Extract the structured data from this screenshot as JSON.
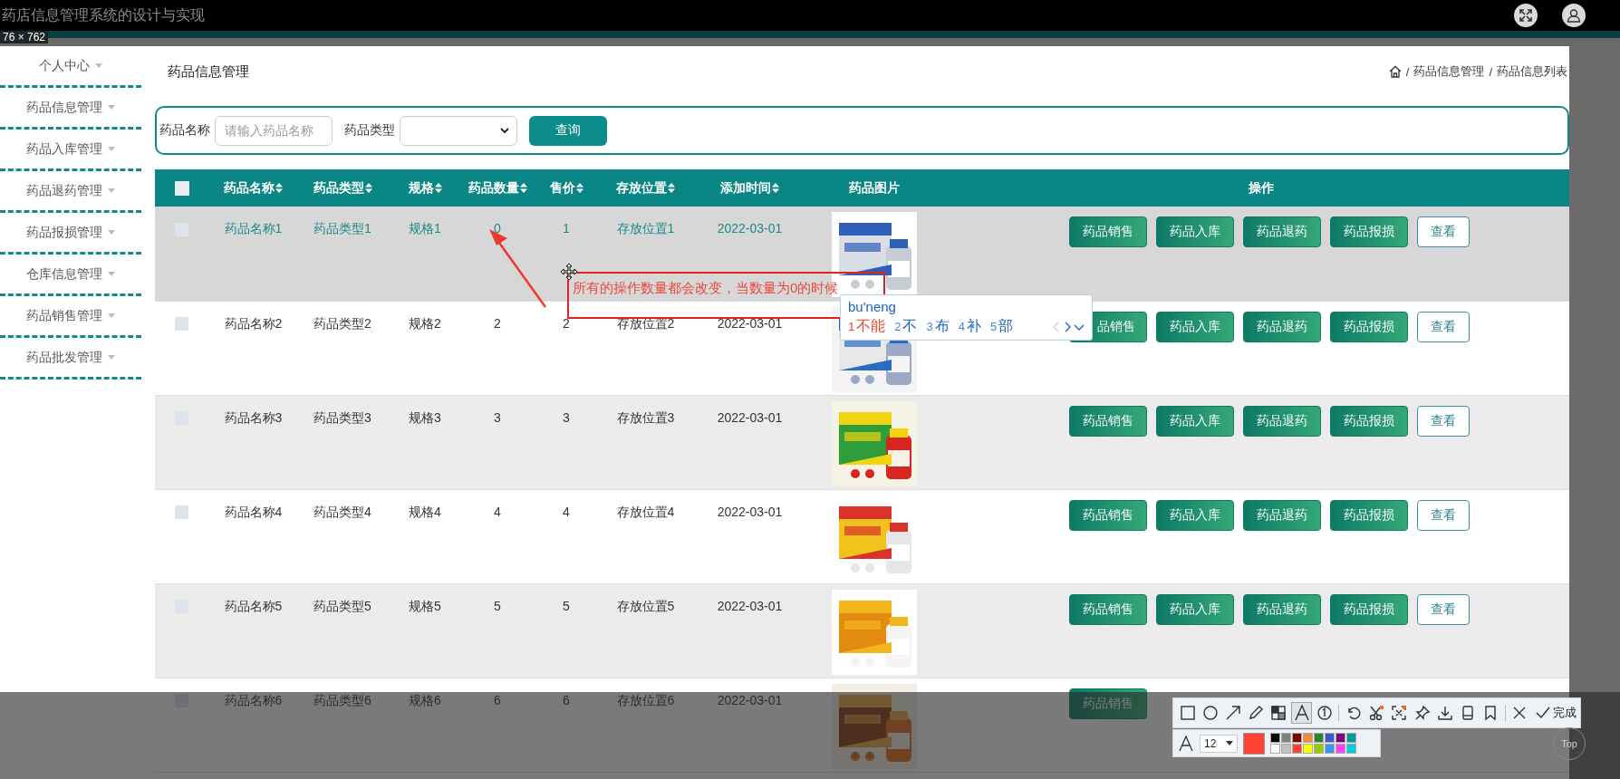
{
  "titlebar": {
    "title": "药店信息管理系统的设计与实现"
  },
  "capture": {
    "size_label": "76 × 762",
    "annotation": {
      "text": "所有的操作数量都会改变，当数量为0的时候"
    },
    "ime": {
      "input": "bu'neng",
      "candidates": [
        {
          "index": "1",
          "text": "不能",
          "selected": true
        },
        {
          "index": "2",
          "text": "不",
          "selected": false
        },
        {
          "index": "3",
          "text": "布",
          "selected": false
        },
        {
          "index": "4",
          "text": "补",
          "selected": false
        },
        {
          "index": "5",
          "text": "部",
          "selected": false
        }
      ]
    },
    "toolbar": {
      "tools": [
        {
          "kind": "rectangle",
          "selected": false
        },
        {
          "kind": "circle",
          "selected": false
        },
        {
          "kind": "arrow",
          "selected": false
        },
        {
          "kind": "pencil",
          "selected": false
        },
        {
          "kind": "mosaic",
          "selected": false
        },
        {
          "kind": "text",
          "selected": true
        },
        {
          "kind": "number",
          "selected": false
        },
        {
          "kind": "undo",
          "selected": false
        },
        {
          "kind": "scissors",
          "selected": false
        },
        {
          "kind": "bracket",
          "selected": false
        },
        {
          "kind": "pin",
          "selected": false
        },
        {
          "kind": "download",
          "selected": false
        },
        {
          "kind": "phone",
          "selected": false
        },
        {
          "kind": "bookmark",
          "selected": false
        },
        {
          "kind": "close",
          "selected": false
        }
      ],
      "done_label": "完成",
      "size_value": "12",
      "palette": [
        {
          "color": "#000000"
        },
        {
          "color": "#808080"
        },
        {
          "color": "#800000"
        },
        {
          "color": "#f7883a"
        },
        {
          "color": "#308430"
        },
        {
          "color": "#385ad3"
        },
        {
          "color": "#800080"
        },
        {
          "color": "#009999"
        },
        {
          "color": "#ffffff"
        },
        {
          "color": "#c0c0c0"
        },
        {
          "color": "#ff4433",
          "selected": true
        },
        {
          "color": "#ffff00"
        },
        {
          "color": "#99cc00"
        },
        {
          "color": "#3d95ee"
        },
        {
          "color": "#ff40ff"
        },
        {
          "color": "#00cfe0"
        }
      ]
    }
  },
  "sidebar": {
    "items": [
      {
        "label": "个人中心"
      },
      {
        "label": "药品信息管理"
      },
      {
        "label": "药品入库管理"
      },
      {
        "label": "药品退药管理"
      },
      {
        "label": "药品报损管理"
      },
      {
        "label": "仓库信息管理"
      },
      {
        "label": "药品销售管理"
      },
      {
        "label": "药品批发管理"
      }
    ]
  },
  "page": {
    "title": "药品信息管理",
    "breadcrumb": [
      {
        "kind": "home"
      },
      {
        "kind": "sep",
        "text": "/"
      },
      {
        "kind": "link",
        "text": "药品信息管理"
      },
      {
        "kind": "sep",
        "text": "/"
      },
      {
        "kind": "link",
        "text": "药品信息列表"
      }
    ]
  },
  "search": {
    "fields": [
      {
        "label": "药品名称",
        "kind": "text",
        "placeholder": "请输入药品名称"
      },
      {
        "label": "药品类型",
        "kind": "select"
      }
    ],
    "button": "查询"
  },
  "table": {
    "select_all_checked": false,
    "columns": [
      {
        "label": "药品名称",
        "sortable": true
      },
      {
        "label": "药品类型",
        "sortable": true
      },
      {
        "label": "规格",
        "sortable": true
      },
      {
        "label": "药品数量",
        "sortable": true
      },
      {
        "label": "售价",
        "sortable": true
      },
      {
        "label": "存放位置",
        "sortable": true
      },
      {
        "label": "添加时间",
        "sortable": true
      },
      {
        "label": "药品图片",
        "sortable": false
      },
      {
        "label": "操作",
        "sortable": false
      }
    ],
    "rows": [
      {
        "hovered": true,
        "checked": false,
        "cells": [
          "药品名称1",
          "药品类型1",
          "规格1",
          "0",
          "1",
          "存放位置1",
          "2022-03-01"
        ],
        "image": {
          "kind": "picture"
        },
        "actions": [
          {
            "label": "药品销售",
            "kind": "filled"
          },
          {
            "label": "药品入库",
            "kind": "filled"
          },
          {
            "label": "药品退药",
            "kind": "filled"
          },
          {
            "label": "药品报损",
            "kind": "filled"
          },
          {
            "label": "查看",
            "kind": "outline"
          }
        ]
      },
      {
        "hovered": false,
        "checked": false,
        "cells": [
          "药品名称2",
          "药品类型2",
          "规格2",
          "2",
          "2",
          "存放位置2",
          "2022-03-01"
        ],
        "image": {
          "kind": "picture"
        },
        "actions": [
          {
            "label": "品销售",
            "kind": "covered"
          },
          {
            "label": "药品入库",
            "kind": "filled"
          },
          {
            "label": "药品退药",
            "kind": "filled"
          },
          {
            "label": "药品报损",
            "kind": "filled"
          },
          {
            "label": "查看",
            "kind": "outline"
          }
        ]
      },
      {
        "hovered": false,
        "checked": false,
        "cells": [
          "药品名称3",
          "药品类型3",
          "规格3",
          "3",
          "3",
          "存放位置3",
          "2022-03-01"
        ],
        "image": {
          "kind": "picture"
        },
        "actions": [
          {
            "label": "药品销售",
            "kind": "filled"
          },
          {
            "label": "药品入库",
            "kind": "filled"
          },
          {
            "label": "药品退药",
            "kind": "filled"
          },
          {
            "label": "药品报损",
            "kind": "filled"
          },
          {
            "label": "查看",
            "kind": "outline"
          }
        ]
      },
      {
        "hovered": false,
        "checked": false,
        "cells": [
          "药品名称4",
          "药品类型4",
          "规格4",
          "4",
          "4",
          "存放位置4",
          "2022-03-01"
        ],
        "image": {
          "kind": "picture"
        },
        "actions": [
          {
            "label": "药品销售",
            "kind": "filled"
          },
          {
            "label": "药品入库",
            "kind": "filled"
          },
          {
            "label": "药品退药",
            "kind": "filled"
          },
          {
            "label": "药品报损",
            "kind": "filled"
          },
          {
            "label": "查看",
            "kind": "outline"
          }
        ]
      },
      {
        "hovered": false,
        "checked": false,
        "cells": [
          "药品名称5",
          "药品类型5",
          "规格5",
          "5",
          "5",
          "存放位置5",
          "2022-03-01"
        ],
        "image": {
          "kind": "picture"
        },
        "actions": [
          {
            "label": "药品销售",
            "kind": "filled"
          },
          {
            "label": "药品入库",
            "kind": "filled"
          },
          {
            "label": "药品退药",
            "kind": "filled"
          },
          {
            "label": "药品报损",
            "kind": "filled"
          },
          {
            "label": "查看",
            "kind": "outline"
          }
        ]
      },
      {
        "hovered": false,
        "checked": false,
        "cells": [
          "药品名称6",
          "药品类型6",
          "规格6",
          "6",
          "6",
          "存放位置6",
          "2022-03-01"
        ],
        "image": {
          "kind": "picture"
        },
        "actions": [
          {
            "label": "药品销售",
            "kind": "filled"
          }
        ]
      }
    ]
  },
  "back_to_top": "Top"
}
